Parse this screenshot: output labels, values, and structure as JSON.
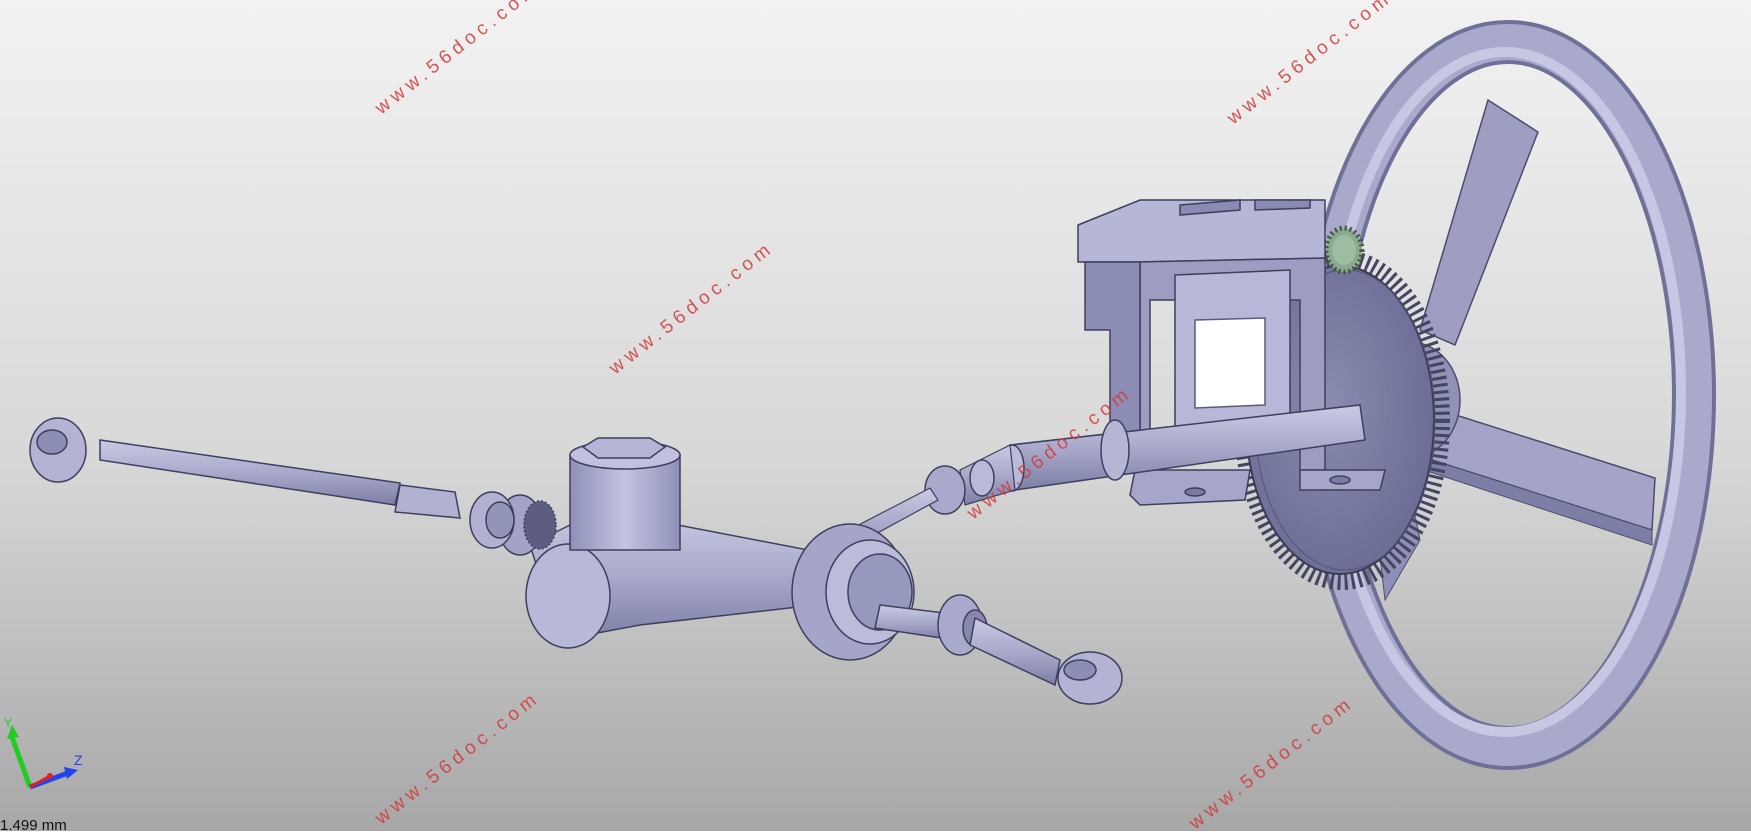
{
  "viewer": {
    "scale_readout": "1.499 mm",
    "background_top": "#f2f2f2",
    "background_bottom": "#a7a7a7",
    "part_color": "#a9aacb",
    "part_shadow_color": "#7d7ea6",
    "pinion_color": "#8aa98e"
  },
  "axes": {
    "y_label": "Y",
    "z_label": "Z",
    "x_label": "X",
    "y_color": "#22cc22",
    "z_color": "#2244ee",
    "x_color": "#dd2222"
  },
  "watermark": {
    "text": "www.56doc.com",
    "color": "#d23a3a"
  },
  "model": {
    "parts": [
      "steering-wheel",
      "steering-gear",
      "pinion-gear",
      "mounting-bracket",
      "steering-column",
      "universal-joint",
      "rack-housing",
      "tie-rod-left",
      "tie-rod-right"
    ]
  }
}
